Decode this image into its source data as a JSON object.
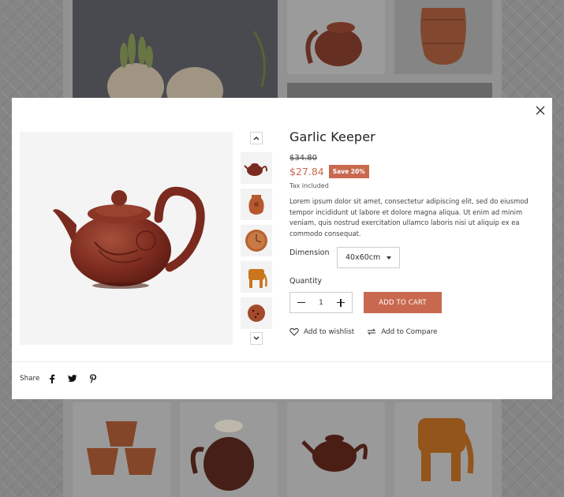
{
  "product": {
    "title": "Garlic Keeper",
    "old_price": "$34.80",
    "price": "$27.84",
    "save_badge": "Save 20%",
    "tax_note": "Tax included",
    "description": "Lorem ipsum dolor sit amet, consectetur adipiscing elit, sed do eiusmod tempor incididunt ut labore et dolore magna aliqua. Ut enim ad minim veniam, quis nostrud exercitation ullamco laboris nisi ut aliquip ex ea commodo consequat."
  },
  "dimension": {
    "label": "Dimension",
    "selected": "40x60cm"
  },
  "quantity": {
    "label": "Quantity",
    "value": "1"
  },
  "actions": {
    "add_to_cart": "ADD TO CART",
    "wishlist": "Add to wishlist",
    "compare": "Add to Compare"
  },
  "share": {
    "label": "Share"
  },
  "icons": {
    "close": "close-icon",
    "up": "chevron-up-icon",
    "down": "chevron-down-icon",
    "minus": "minus-icon",
    "plus": "plus-icon",
    "heart": "heart-icon",
    "compare": "compare-icon",
    "facebook": "facebook-icon",
    "twitter": "twitter-icon",
    "pinterest": "pinterest-icon"
  },
  "colors": {
    "accent": "#c8694f",
    "modal_bg": "#ffffff",
    "clay": "#7f2a1f"
  }
}
